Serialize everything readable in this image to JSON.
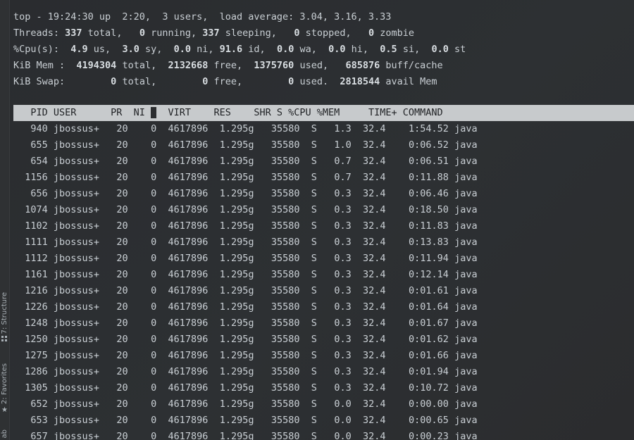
{
  "sidebar": {
    "structure_label": "7: Structure",
    "favorites_label": "2: Favorites",
    "extra_label": "ab"
  },
  "summary": {
    "line1": "top - 19:24:30 up  2:20,  3 users,  load average: 3.04, 3.16, 3.33",
    "threads": {
      "prefix": "Threads: ",
      "total": "337",
      "total_label": " total,   ",
      "running": "0",
      "running_label": " running, ",
      "sleeping": "337",
      "sleeping_label": " sleeping,   ",
      "stopped": "0",
      "stopped_label": " stopped,   ",
      "zombie": "0",
      "zombie_label": " zombie"
    },
    "cpu": {
      "prefix": "%Cpu(s):  ",
      "us": "4.9",
      "us_label": " us,  ",
      "sy": "3.0",
      "sy_label": " sy,  ",
      "ni": "0.0",
      "ni_label": " ni, ",
      "id": "91.6",
      "id_label": " id,  ",
      "wa": "0.0",
      "wa_label": " wa,  ",
      "hi": "0.0",
      "hi_label": " hi,  ",
      "si": "0.5",
      "si_label": " si,  ",
      "st": "0.0",
      "st_label": " st"
    },
    "mem": {
      "prefix": "KiB Mem :  ",
      "total": "4194304",
      "total_label": " total,  ",
      "free": "2132668",
      "free_label": " free,  ",
      "used": "1375760",
      "used_label": " used,   ",
      "buff": "685876",
      "buff_label": " buff/cache"
    },
    "swap": {
      "prefix": "KiB Swap:        ",
      "total": "0",
      "total_label": " total,        ",
      "free": "0",
      "free_label": " free,        ",
      "used": "0",
      "used_label": " used.  ",
      "avail": "2818544",
      "avail_label": " avail Mem"
    }
  },
  "table": {
    "header_left": "   PID USER      PR  NI ",
    "header_gap": " ",
    "header_right": "  VIRT    RES    SHR S %CPU %MEM     TIME+ COMMAND",
    "rows": [
      [
        "940",
        "jbossus+",
        "20",
        "0",
        "4617896",
        "1.295g",
        "35580",
        "S",
        "1.3",
        "32.4",
        "1:54.52",
        "java"
      ],
      [
        "655",
        "jbossus+",
        "20",
        "0",
        "4617896",
        "1.295g",
        "35580",
        "S",
        "1.0",
        "32.4",
        "0:06.52",
        "java"
      ],
      [
        "654",
        "jbossus+",
        "20",
        "0",
        "4617896",
        "1.295g",
        "35580",
        "S",
        "0.7",
        "32.4",
        "0:06.51",
        "java"
      ],
      [
        "1156",
        "jbossus+",
        "20",
        "0",
        "4617896",
        "1.295g",
        "35580",
        "S",
        "0.7",
        "32.4",
        "0:11.88",
        "java"
      ],
      [
        "656",
        "jbossus+",
        "20",
        "0",
        "4617896",
        "1.295g",
        "35580",
        "S",
        "0.3",
        "32.4",
        "0:06.46",
        "java"
      ],
      [
        "1074",
        "jbossus+",
        "20",
        "0",
        "4617896",
        "1.295g",
        "35580",
        "S",
        "0.3",
        "32.4",
        "0:18.50",
        "java"
      ],
      [
        "1102",
        "jbossus+",
        "20",
        "0",
        "4617896",
        "1.295g",
        "35580",
        "S",
        "0.3",
        "32.4",
        "0:11.83",
        "java"
      ],
      [
        "1111",
        "jbossus+",
        "20",
        "0",
        "4617896",
        "1.295g",
        "35580",
        "S",
        "0.3",
        "32.4",
        "0:13.83",
        "java"
      ],
      [
        "1112",
        "jbossus+",
        "20",
        "0",
        "4617896",
        "1.295g",
        "35580",
        "S",
        "0.3",
        "32.4",
        "0:11.94",
        "java"
      ],
      [
        "1161",
        "jbossus+",
        "20",
        "0",
        "4617896",
        "1.295g",
        "35580",
        "S",
        "0.3",
        "32.4",
        "0:12.14",
        "java"
      ],
      [
        "1216",
        "jbossus+",
        "20",
        "0",
        "4617896",
        "1.295g",
        "35580",
        "S",
        "0.3",
        "32.4",
        "0:01.61",
        "java"
      ],
      [
        "1226",
        "jbossus+",
        "20",
        "0",
        "4617896",
        "1.295g",
        "35580",
        "S",
        "0.3",
        "32.4",
        "0:01.64",
        "java"
      ],
      [
        "1248",
        "jbossus+",
        "20",
        "0",
        "4617896",
        "1.295g",
        "35580",
        "S",
        "0.3",
        "32.4",
        "0:01.67",
        "java"
      ],
      [
        "1250",
        "jbossus+",
        "20",
        "0",
        "4617896",
        "1.295g",
        "35580",
        "S",
        "0.3",
        "32.4",
        "0:01.62",
        "java"
      ],
      [
        "1275",
        "jbossus+",
        "20",
        "0",
        "4617896",
        "1.295g",
        "35580",
        "S",
        "0.3",
        "32.4",
        "0:01.66",
        "java"
      ],
      [
        "1286",
        "jbossus+",
        "20",
        "0",
        "4617896",
        "1.295g",
        "35580",
        "S",
        "0.3",
        "32.4",
        "0:01.94",
        "java"
      ],
      [
        "1305",
        "jbossus+",
        "20",
        "0",
        "4617896",
        "1.295g",
        "35580",
        "S",
        "0.3",
        "32.4",
        "0:10.72",
        "java"
      ],
      [
        "652",
        "jbossus+",
        "20",
        "0",
        "4617896",
        "1.295g",
        "35580",
        "S",
        "0.0",
        "32.4",
        "0:00.00",
        "java"
      ],
      [
        "653",
        "jbossus+",
        "20",
        "0",
        "4617896",
        "1.295g",
        "35580",
        "S",
        "0.0",
        "32.4",
        "0:00.65",
        "java"
      ],
      [
        "657",
        "jbossus+",
        "20",
        "0",
        "4617896",
        "1.295g",
        "35580",
        "S",
        "0.0",
        "32.4",
        "0:00.23",
        "java"
      ]
    ]
  }
}
